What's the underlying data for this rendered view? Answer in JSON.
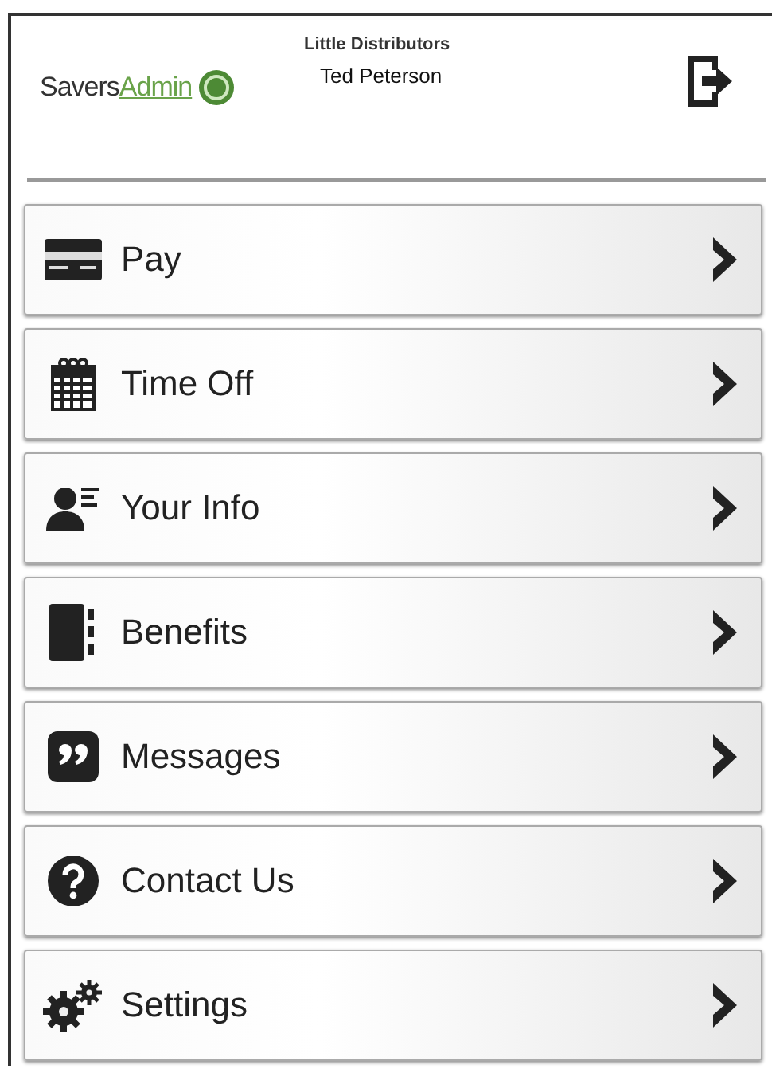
{
  "header": {
    "logo": {
      "primary": "Savers",
      "secondary": "Admin"
    },
    "company": "Little Distributors",
    "user": "Ted Peterson"
  },
  "menu": [
    {
      "kind": "pay",
      "label": "Pay"
    },
    {
      "kind": "calendar",
      "label": "Time Off"
    },
    {
      "kind": "person",
      "label": "Your Info"
    },
    {
      "kind": "book",
      "label": "Benefits"
    },
    {
      "kind": "quote",
      "label": "Messages"
    },
    {
      "kind": "help",
      "label": "Contact Us"
    },
    {
      "kind": "gears",
      "label": "Settings"
    }
  ]
}
